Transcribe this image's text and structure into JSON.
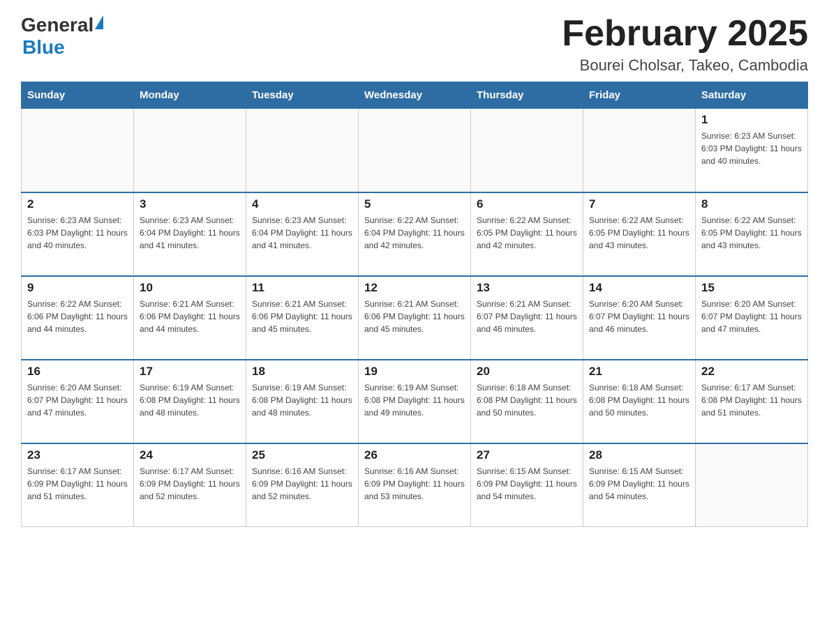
{
  "header": {
    "logo": {
      "general": "General",
      "blue": "Blue",
      "tagline": "GeneralBlue"
    },
    "title": "February 2025",
    "subtitle": "Bourei Cholsar, Takeo, Cambodia"
  },
  "calendar": {
    "days_of_week": [
      "Sunday",
      "Monday",
      "Tuesday",
      "Wednesday",
      "Thursday",
      "Friday",
      "Saturday"
    ],
    "weeks": [
      [
        {
          "day": "",
          "info": ""
        },
        {
          "day": "",
          "info": ""
        },
        {
          "day": "",
          "info": ""
        },
        {
          "day": "",
          "info": ""
        },
        {
          "day": "",
          "info": ""
        },
        {
          "day": "",
          "info": ""
        },
        {
          "day": "1",
          "info": "Sunrise: 6:23 AM\nSunset: 6:03 PM\nDaylight: 11 hours and 40 minutes."
        }
      ],
      [
        {
          "day": "2",
          "info": "Sunrise: 6:23 AM\nSunset: 6:03 PM\nDaylight: 11 hours and 40 minutes."
        },
        {
          "day": "3",
          "info": "Sunrise: 6:23 AM\nSunset: 6:04 PM\nDaylight: 11 hours and 41 minutes."
        },
        {
          "day": "4",
          "info": "Sunrise: 6:23 AM\nSunset: 6:04 PM\nDaylight: 11 hours and 41 minutes."
        },
        {
          "day": "5",
          "info": "Sunrise: 6:22 AM\nSunset: 6:04 PM\nDaylight: 11 hours and 42 minutes."
        },
        {
          "day": "6",
          "info": "Sunrise: 6:22 AM\nSunset: 6:05 PM\nDaylight: 11 hours and 42 minutes."
        },
        {
          "day": "7",
          "info": "Sunrise: 6:22 AM\nSunset: 6:05 PM\nDaylight: 11 hours and 43 minutes."
        },
        {
          "day": "8",
          "info": "Sunrise: 6:22 AM\nSunset: 6:05 PM\nDaylight: 11 hours and 43 minutes."
        }
      ],
      [
        {
          "day": "9",
          "info": "Sunrise: 6:22 AM\nSunset: 6:06 PM\nDaylight: 11 hours and 44 minutes."
        },
        {
          "day": "10",
          "info": "Sunrise: 6:21 AM\nSunset: 6:06 PM\nDaylight: 11 hours and 44 minutes."
        },
        {
          "day": "11",
          "info": "Sunrise: 6:21 AM\nSunset: 6:06 PM\nDaylight: 11 hours and 45 minutes."
        },
        {
          "day": "12",
          "info": "Sunrise: 6:21 AM\nSunset: 6:06 PM\nDaylight: 11 hours and 45 minutes."
        },
        {
          "day": "13",
          "info": "Sunrise: 6:21 AM\nSunset: 6:07 PM\nDaylight: 11 hours and 46 minutes."
        },
        {
          "day": "14",
          "info": "Sunrise: 6:20 AM\nSunset: 6:07 PM\nDaylight: 11 hours and 46 minutes."
        },
        {
          "day": "15",
          "info": "Sunrise: 6:20 AM\nSunset: 6:07 PM\nDaylight: 11 hours and 47 minutes."
        }
      ],
      [
        {
          "day": "16",
          "info": "Sunrise: 6:20 AM\nSunset: 6:07 PM\nDaylight: 11 hours and 47 minutes."
        },
        {
          "day": "17",
          "info": "Sunrise: 6:19 AM\nSunset: 6:08 PM\nDaylight: 11 hours and 48 minutes."
        },
        {
          "day": "18",
          "info": "Sunrise: 6:19 AM\nSunset: 6:08 PM\nDaylight: 11 hours and 48 minutes."
        },
        {
          "day": "19",
          "info": "Sunrise: 6:19 AM\nSunset: 6:08 PM\nDaylight: 11 hours and 49 minutes."
        },
        {
          "day": "20",
          "info": "Sunrise: 6:18 AM\nSunset: 6:08 PM\nDaylight: 11 hours and 50 minutes."
        },
        {
          "day": "21",
          "info": "Sunrise: 6:18 AM\nSunset: 6:08 PM\nDaylight: 11 hours and 50 minutes."
        },
        {
          "day": "22",
          "info": "Sunrise: 6:17 AM\nSunset: 6:08 PM\nDaylight: 11 hours and 51 minutes."
        }
      ],
      [
        {
          "day": "23",
          "info": "Sunrise: 6:17 AM\nSunset: 6:09 PM\nDaylight: 11 hours and 51 minutes."
        },
        {
          "day": "24",
          "info": "Sunrise: 6:17 AM\nSunset: 6:09 PM\nDaylight: 11 hours and 52 minutes."
        },
        {
          "day": "25",
          "info": "Sunrise: 6:16 AM\nSunset: 6:09 PM\nDaylight: 11 hours and 52 minutes."
        },
        {
          "day": "26",
          "info": "Sunrise: 6:16 AM\nSunset: 6:09 PM\nDaylight: 11 hours and 53 minutes."
        },
        {
          "day": "27",
          "info": "Sunrise: 6:15 AM\nSunset: 6:09 PM\nDaylight: 11 hours and 54 minutes."
        },
        {
          "day": "28",
          "info": "Sunrise: 6:15 AM\nSunset: 6:09 PM\nDaylight: 11 hours and 54 minutes."
        },
        {
          "day": "",
          "info": ""
        }
      ]
    ]
  }
}
